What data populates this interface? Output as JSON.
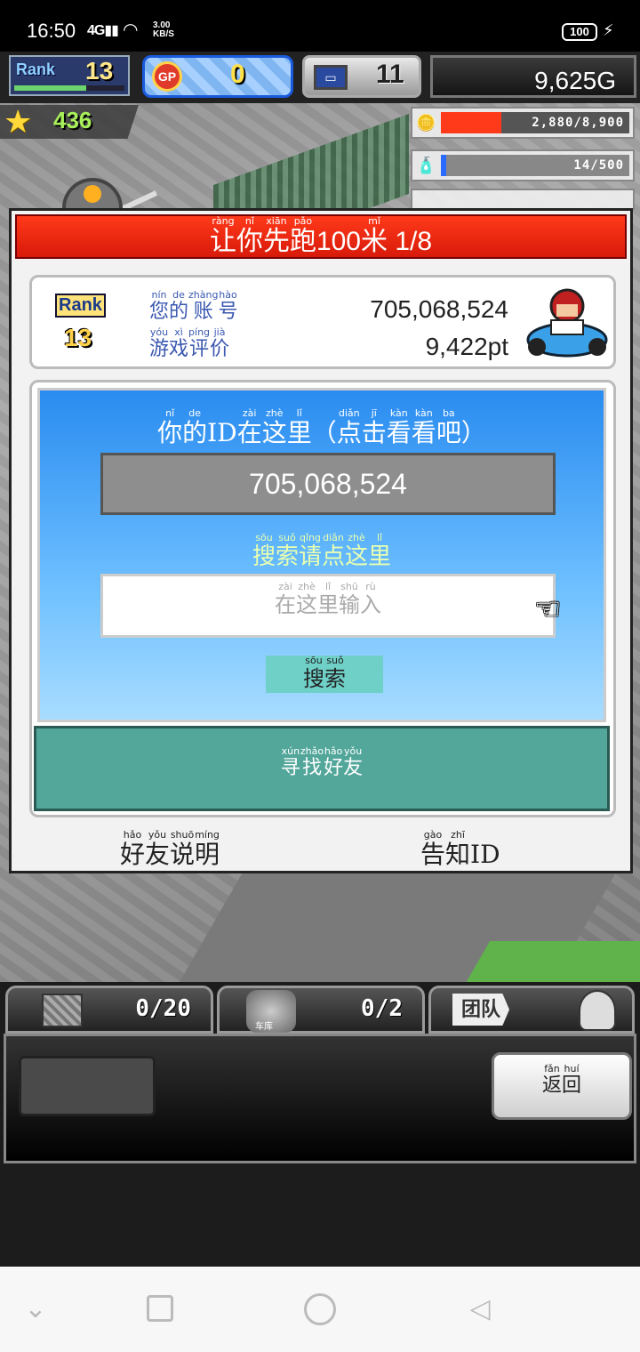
{
  "status_bar": {
    "time": "16:50",
    "signal": "4G",
    "speed_value": "3.00",
    "speed_unit": "KB/S",
    "battery": "100"
  },
  "hud": {
    "rank_label": "Rank",
    "rank_value": "13",
    "gp_label": "GP",
    "gp_value": "0",
    "pc_value": "11",
    "gold": "9,625G",
    "stars": "436",
    "resources": [
      {
        "icon": "coin-stack-icon",
        "text": "2,880/8,900",
        "fill": 0.32,
        "color": "#ff3a1a"
      },
      {
        "icon": "bottle-icon",
        "text": "14/500",
        "fill": 0.03,
        "color": "#2a6aff"
      }
    ]
  },
  "dialog": {
    "title_text": "让你先跑",
    "title_num": "100",
    "title_unit": "米",
    "title_progress": "1/8",
    "account_label": "您的账号",
    "account_value": "705,068,524",
    "rating_label": "游戏评价",
    "rating_value": "9,422pt",
    "rank_label": "Rank",
    "rank_value": "13",
    "id_heading_pre": "你的",
    "id_heading_id": "ID",
    "id_heading_post": "在这里（点击看看吧）",
    "id_value": "705,068,524",
    "search_heading": "搜索请点这里",
    "search_placeholder": "在这里输入",
    "search_button": "搜索",
    "find_friends": "寻找好友",
    "friend_help": "好友说明",
    "notify_id_pre": "告知",
    "notify_id": "ID"
  },
  "bottom_hud": {
    "tab1_count": "0/20",
    "tab2_label": "车库",
    "tab2_count": "0/2",
    "tab3_label": "团队",
    "back_button": "返回"
  }
}
